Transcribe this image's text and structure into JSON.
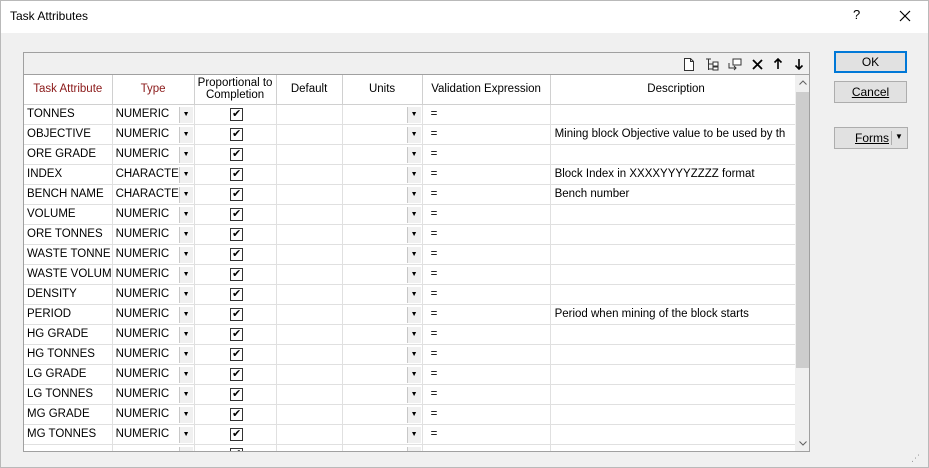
{
  "window": {
    "title": "Task Attributes",
    "help_glyph": "?",
    "close_glyph": "✕"
  },
  "toolbar": {
    "icons": [
      "new-row-icon",
      "insert-row-icon",
      "insert-above-icon",
      "delete-row-icon",
      "move-up-icon",
      "move-down-icon"
    ]
  },
  "grid": {
    "headers": {
      "task_attribute": "Task Attribute",
      "type": "Type",
      "proportional": "Proportional to Completion",
      "default": "Default",
      "units": "Units",
      "validation": "Validation Expression",
      "description": "Description"
    },
    "rows": [
      {
        "attribute": "TONNES",
        "type": "NUMERIC",
        "checked": true,
        "validation": "=",
        "description": ""
      },
      {
        "attribute": "OBJECTIVE",
        "type": "NUMERIC",
        "checked": true,
        "validation": "=",
        "description": "Mining block Objective value to be used by th"
      },
      {
        "attribute": "ORE GRADE",
        "type": "NUMERIC",
        "checked": true,
        "validation": "=",
        "description": ""
      },
      {
        "attribute": "INDEX",
        "type": "CHARACTEF",
        "checked": true,
        "validation": "=",
        "description": "Block Index in XXXXYYYYZZZZ format"
      },
      {
        "attribute": "BENCH NAME",
        "type": "CHARACTEF",
        "checked": true,
        "validation": "=",
        "description": "Bench number"
      },
      {
        "attribute": "VOLUME",
        "type": "NUMERIC",
        "checked": true,
        "validation": "=",
        "description": ""
      },
      {
        "attribute": "ORE TONNES",
        "type": "NUMERIC",
        "checked": true,
        "validation": "=",
        "description": ""
      },
      {
        "attribute": "WASTE TONNE",
        "type": "NUMERIC",
        "checked": true,
        "validation": "=",
        "description": ""
      },
      {
        "attribute": "WASTE VOLUM",
        "type": "NUMERIC",
        "checked": true,
        "validation": "=",
        "description": ""
      },
      {
        "attribute": "DENSITY",
        "type": "NUMERIC",
        "checked": true,
        "validation": "=",
        "description": ""
      },
      {
        "attribute": "PERIOD",
        "type": "NUMERIC",
        "checked": true,
        "validation": "=",
        "description": "Period when mining of the block starts"
      },
      {
        "attribute": "HG GRADE",
        "type": "NUMERIC",
        "checked": true,
        "validation": "=",
        "description": ""
      },
      {
        "attribute": "HG TONNES",
        "type": "NUMERIC",
        "checked": true,
        "validation": "=",
        "description": ""
      },
      {
        "attribute": "LG GRADE",
        "type": "NUMERIC",
        "checked": true,
        "validation": "=",
        "description": ""
      },
      {
        "attribute": "LG TONNES",
        "type": "NUMERIC",
        "checked": true,
        "validation": "=",
        "description": ""
      },
      {
        "attribute": "MG GRADE",
        "type": "NUMERIC",
        "checked": true,
        "validation": "=",
        "description": ""
      },
      {
        "attribute": "MG TONNES",
        "type": "NUMERIC",
        "checked": true,
        "validation": "=",
        "description": ""
      },
      {
        "attribute": "",
        "type": "",
        "checked": true,
        "validation": "",
        "description": ""
      }
    ]
  },
  "buttons": {
    "ok": "OK",
    "cancel": "Cancel",
    "forms": "Forms"
  }
}
